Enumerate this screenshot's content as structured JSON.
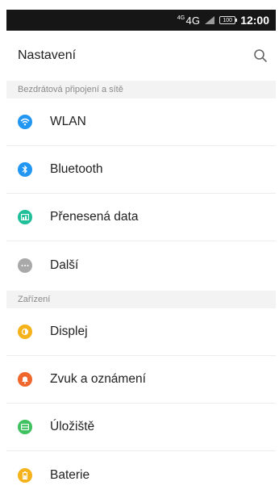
{
  "status_bar": {
    "network_super": "4G",
    "network": "4G",
    "battery": "100",
    "time": "12:00"
  },
  "header": {
    "title": "Nastavení",
    "search_icon": "search-icon"
  },
  "sections": [
    {
      "title": "Bezdrátová připojení a sítě",
      "items": [
        {
          "label": "WLAN",
          "icon": "wifi-icon",
          "color": "#2196f3"
        },
        {
          "label": "Bluetooth",
          "icon": "bluetooth-icon",
          "color": "#2196f3"
        },
        {
          "label": "Přenesená data",
          "icon": "data-usage-icon",
          "color": "#1fbf9a"
        },
        {
          "label": "Další",
          "icon": "more-icon",
          "color": "#a9a9a9"
        }
      ]
    },
    {
      "title": "Zařízení",
      "items": [
        {
          "label": "Displej",
          "icon": "display-icon",
          "color": "#f6b21a"
        },
        {
          "label": "Zvuk a oznámení",
          "icon": "bell-icon",
          "color": "#f0672d"
        },
        {
          "label": "Úložiště",
          "icon": "storage-icon",
          "color": "#3ec15e"
        },
        {
          "label": "Baterie",
          "icon": "battery-icon",
          "color": "#f6b21a"
        }
      ]
    }
  ]
}
